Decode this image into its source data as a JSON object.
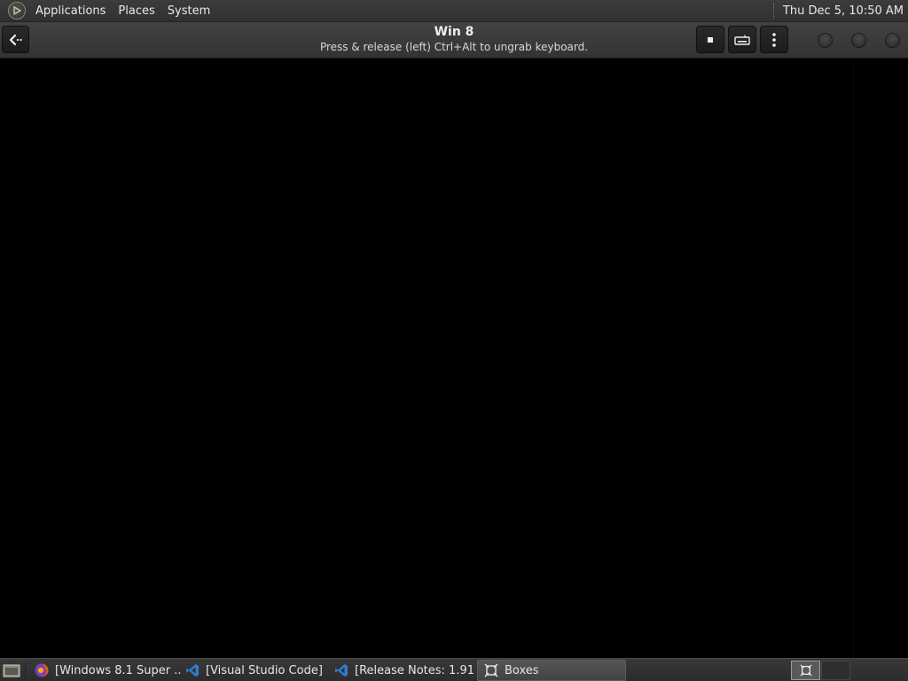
{
  "top_panel": {
    "menus": [
      "Applications",
      "Places",
      "System"
    ],
    "clock": "Thu Dec  5, 10:50 AM"
  },
  "header": {
    "title": "Win 8",
    "subtitle": "Press & release (left) Ctrl+Alt to ungrab keyboard."
  },
  "taskbar": {
    "tasks": [
      {
        "label": "[Windows 8.1 Super ...",
        "icon": "firefox-icon"
      },
      {
        "label": "[Visual Studio Code]",
        "icon": "vscode-icon"
      },
      {
        "label": "[Release Notes: 1.91...",
        "icon": "vscode-icon"
      },
      {
        "label": "Boxes",
        "icon": "boxes-icon"
      }
    ],
    "active_task": "Boxes"
  },
  "colors": {
    "panel": "#333333",
    "display": "#000000",
    "vscode_blue": "#2f7bd0",
    "firefox_orange": "#e66000",
    "firefox_purple": "#7b3fbf"
  }
}
